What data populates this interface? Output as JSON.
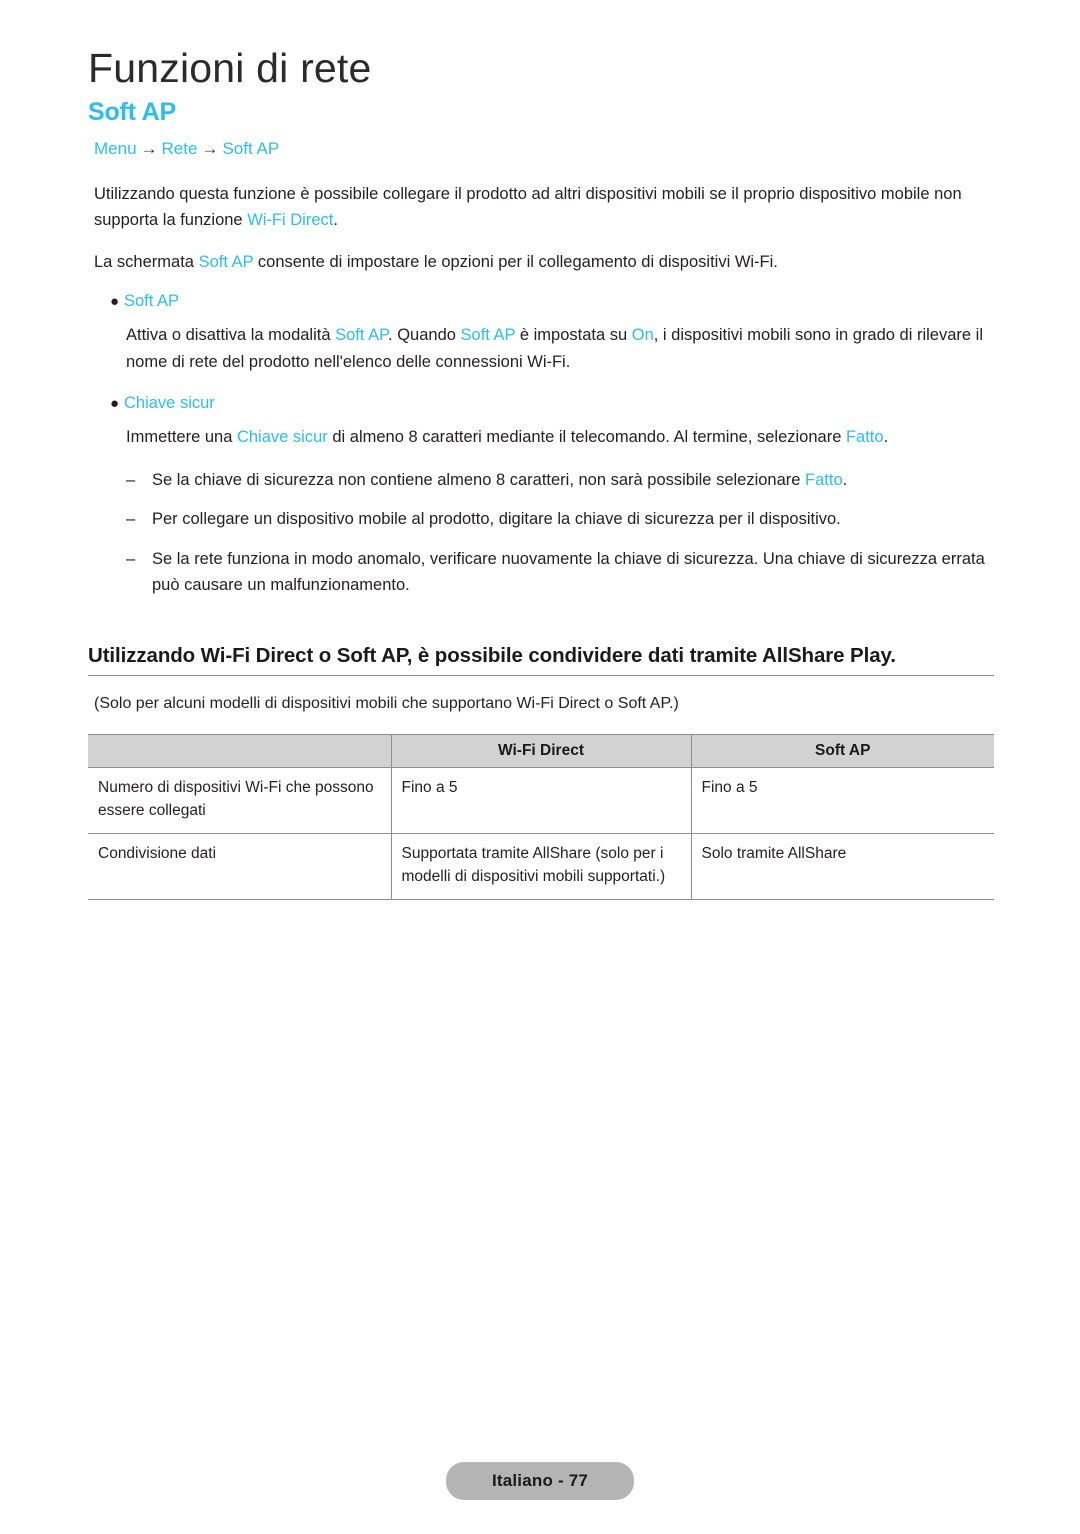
{
  "document": {
    "title": "Funzioni di rete",
    "section_title": "Soft AP"
  },
  "breadcrumb": {
    "items": [
      "Menu",
      "Rete",
      "Soft AP"
    ],
    "separator": "→"
  },
  "intro": {
    "p1_a": "Utilizzando questa funzione è possibile collegare il prodotto ad altri dispositivi mobili se il proprio dispositivo mobile non supporta la funzione ",
    "p1_link": "Wi-Fi Direct",
    "p1_b": ".",
    "p2_a": "La schermata ",
    "p2_link": "Soft AP",
    "p2_b": " consente di impostare le opzioni per il collegamento di dispositivi Wi-Fi."
  },
  "bullets": [
    {
      "label": "Soft AP",
      "body_a": "Attiva o disattiva la modalità ",
      "body_link1": "Soft AP",
      "body_b": ". Quando ",
      "body_link2": "Soft AP",
      "body_c": " è impostata su ",
      "body_link3": "On",
      "body_d": ", i dispositivi mobili sono in grado di rilevare il nome di rete del prodotto nell'elenco delle connessioni Wi-Fi."
    },
    {
      "label": "Chiave sicur",
      "body_a": "Immettere una ",
      "body_link1": "Chiave sicur",
      "body_b": " di almeno 8 caratteri mediante il telecomando. Al termine, selezionare ",
      "body_link2": "Fatto",
      "body_c": "."
    }
  ],
  "dash_items": [
    {
      "mark": "–",
      "text_a": "Se la chiave di sicurezza non contiene almeno 8 caratteri, non sarà possibile selezionare ",
      "text_link": "Fatto",
      "text_b": "."
    },
    {
      "mark": "–",
      "text_a": "Per collegare un dispositivo mobile al prodotto, digitare la chiave di sicurezza per il dispositivo.",
      "text_link": "",
      "text_b": ""
    },
    {
      "mark": "–",
      "text_a": "Se la rete funziona in modo anomalo, verificare nuovamente la chiave di sicurezza. Una chiave di sicurezza errata può causare un malfunzionamento.",
      "text_link": "",
      "text_b": ""
    }
  ],
  "emphasis": {
    "heading": "Utilizzando Wi-Fi Direct o Soft AP, è possibile condividere dati tramite AllShare Play.",
    "note": "(Solo per alcuni modelli di dispositivi mobili che supportano Wi-Fi Direct o Soft AP.)"
  },
  "table": {
    "headers": [
      "",
      "Wi-Fi Direct",
      "Soft AP"
    ],
    "rows": [
      {
        "label": "Numero di dispositivi Wi-Fi che possono essere collegati",
        "wifi_direct": "Fino a 5",
        "soft_ap": "Fino a 5"
      },
      {
        "label": "Condivisione dati",
        "wifi_direct": "Supportata tramite AllShare (solo per i modelli di dispositivi mobili supportati.)",
        "soft_ap": "Solo tramite AllShare"
      }
    ]
  },
  "footer": {
    "label": "Italiano - 77"
  },
  "colors": {
    "accent": "#2bbdf0",
    "text": "#231f20",
    "table_header_bg": "#d2d2d2",
    "table_border": "#8e8e8e",
    "footer_bg": "#b4b4b4"
  }
}
